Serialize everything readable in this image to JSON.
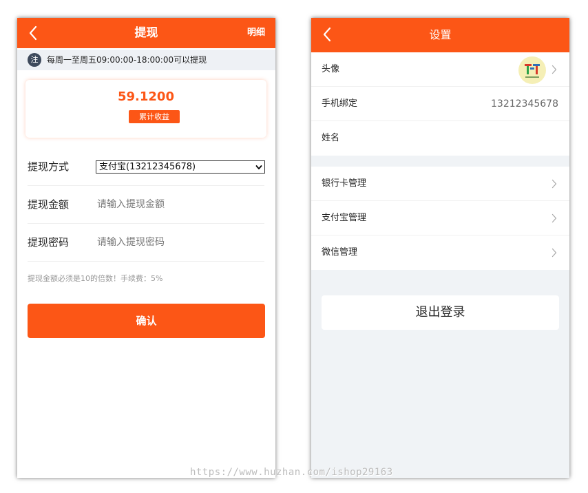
{
  "withdraw": {
    "title": "提现",
    "detail_link": "明细",
    "notice_badge": "注",
    "notice_text": "每周一至周五09:00:00-18:00:00可以提现",
    "earnings_amount": "59.1200",
    "earnings_label": "累计收益",
    "method_label": "提现方式",
    "method_value": "支付宝(13212345678)",
    "amount_label": "提现金额",
    "amount_placeholder": "请输入提现金额",
    "password_label": "提现密码",
    "password_placeholder": "请输入提现密码",
    "hint": "提现金额必须是10的倍数！手续费：5%",
    "confirm_label": "确认"
  },
  "settings": {
    "title": "设置",
    "rows": [
      {
        "label": "头像",
        "value": ""
      },
      {
        "label": "手机绑定",
        "value": "13212345678"
      },
      {
        "label": "姓名",
        "value": ""
      },
      {
        "label": "银行卡管理",
        "value": ""
      },
      {
        "label": "支付宝管理",
        "value": ""
      },
      {
        "label": "微信管理",
        "value": ""
      }
    ],
    "logout_label": "退出登录"
  },
  "watermark": "https://www.huzhan.com/ishop29163",
  "colors": {
    "accent": "#fc5616",
    "page_bg": "#f0f3f6",
    "notice_badge": "#3e4a5c"
  }
}
